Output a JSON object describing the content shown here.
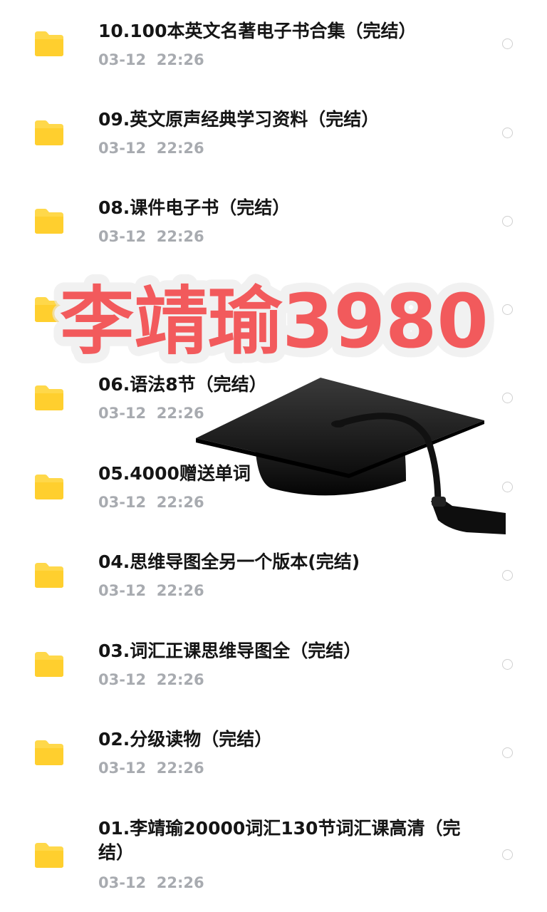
{
  "files": [
    {
      "name": "10.100本英文名著电子书合集（完结）",
      "time": "03-12  22:26"
    },
    {
      "name": "09.英文原声经典学习资料（完结）",
      "time": "03-12  22:26"
    },
    {
      "name": "08.课件电子书（完结）",
      "time": "03-12  22:26"
    },
    {
      "name": "07.",
      "time": ""
    },
    {
      "name": "06.语法8节（完结）",
      "time": "03-12  22:26"
    },
    {
      "name": "05.4000赠送单词",
      "time": "03-12  22:26"
    },
    {
      "name": "04.思维导图全另一个版本(完结)",
      "time": "03-12  22:26"
    },
    {
      "name": "03.词汇正课思维导图全（完结）",
      "time": "03-12  22:26"
    },
    {
      "name": "02.分级读物（完结）",
      "time": "03-12  22:26"
    },
    {
      "name": "01.李靖瑜20000词汇130节词汇课高清（完结）",
      "time": "03-12  22:26"
    }
  ],
  "overlay": {
    "text": "李靖瑜3980",
    "color": "#f25a5c",
    "icon": "graduation-cap-icon"
  },
  "colors": {
    "folder": "#ffd84a",
    "title": "#151515",
    "time": "#a8abb0"
  }
}
